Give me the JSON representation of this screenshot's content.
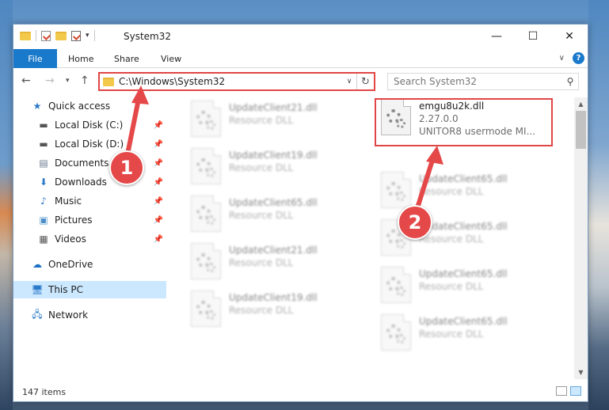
{
  "window": {
    "title": "System32",
    "controls": {
      "minimize": "—",
      "maximize": "☐",
      "close": "✕"
    }
  },
  "ribbon": {
    "tabs": [
      {
        "label": "File"
      },
      {
        "label": "Home"
      },
      {
        "label": "Share"
      },
      {
        "label": "View"
      }
    ]
  },
  "address": {
    "path": "C:\\Windows\\System32",
    "search_placeholder": "Search System32"
  },
  "sidebar": {
    "items": [
      {
        "label": "Quick access"
      },
      {
        "label": "Local Disk (C:)"
      },
      {
        "label": "Local Disk (D:)"
      },
      {
        "label": "Documents"
      },
      {
        "label": "Downloads"
      },
      {
        "label": "Music"
      },
      {
        "label": "Pictures"
      },
      {
        "label": "Videos"
      },
      {
        "label": "OneDrive"
      },
      {
        "label": "This PC"
      },
      {
        "label": "Network"
      }
    ]
  },
  "files": {
    "left_column": [
      {
        "name": "UpdateClient21.dll",
        "type": "Resource DLL"
      },
      {
        "name": "UpdateClient19.dll",
        "type": "Resource DLL"
      },
      {
        "name": "UpdateClient65.dll",
        "type": "Resource DLL"
      },
      {
        "name": "UpdateClient21.dll",
        "type": "Resource DLL"
      },
      {
        "name": "UpdateClient19.dll",
        "type": "Resource DLL"
      }
    ],
    "right_column": [
      {
        "name": "UpdateClient65.dll",
        "type": "Resource DLL"
      },
      {
        "name": "UpdateClient65.dll",
        "type": "Resource DLL"
      },
      {
        "name": "UpdateClient65.dll",
        "type": "Resource DLL"
      },
      {
        "name": "UpdateClient65.dll",
        "type": "Resource DLL"
      }
    ],
    "highlighted": {
      "name": "emgu8u2k.dll",
      "version": "2.27.0.0",
      "description": "UNITOR8 usermode MI..."
    }
  },
  "status": {
    "item_count": "147 items"
  },
  "annotations": {
    "step1": "1",
    "step2": "2"
  },
  "colors": {
    "accent": "#1979ca",
    "annotation": "#e54848",
    "selected": "#cce8ff"
  }
}
